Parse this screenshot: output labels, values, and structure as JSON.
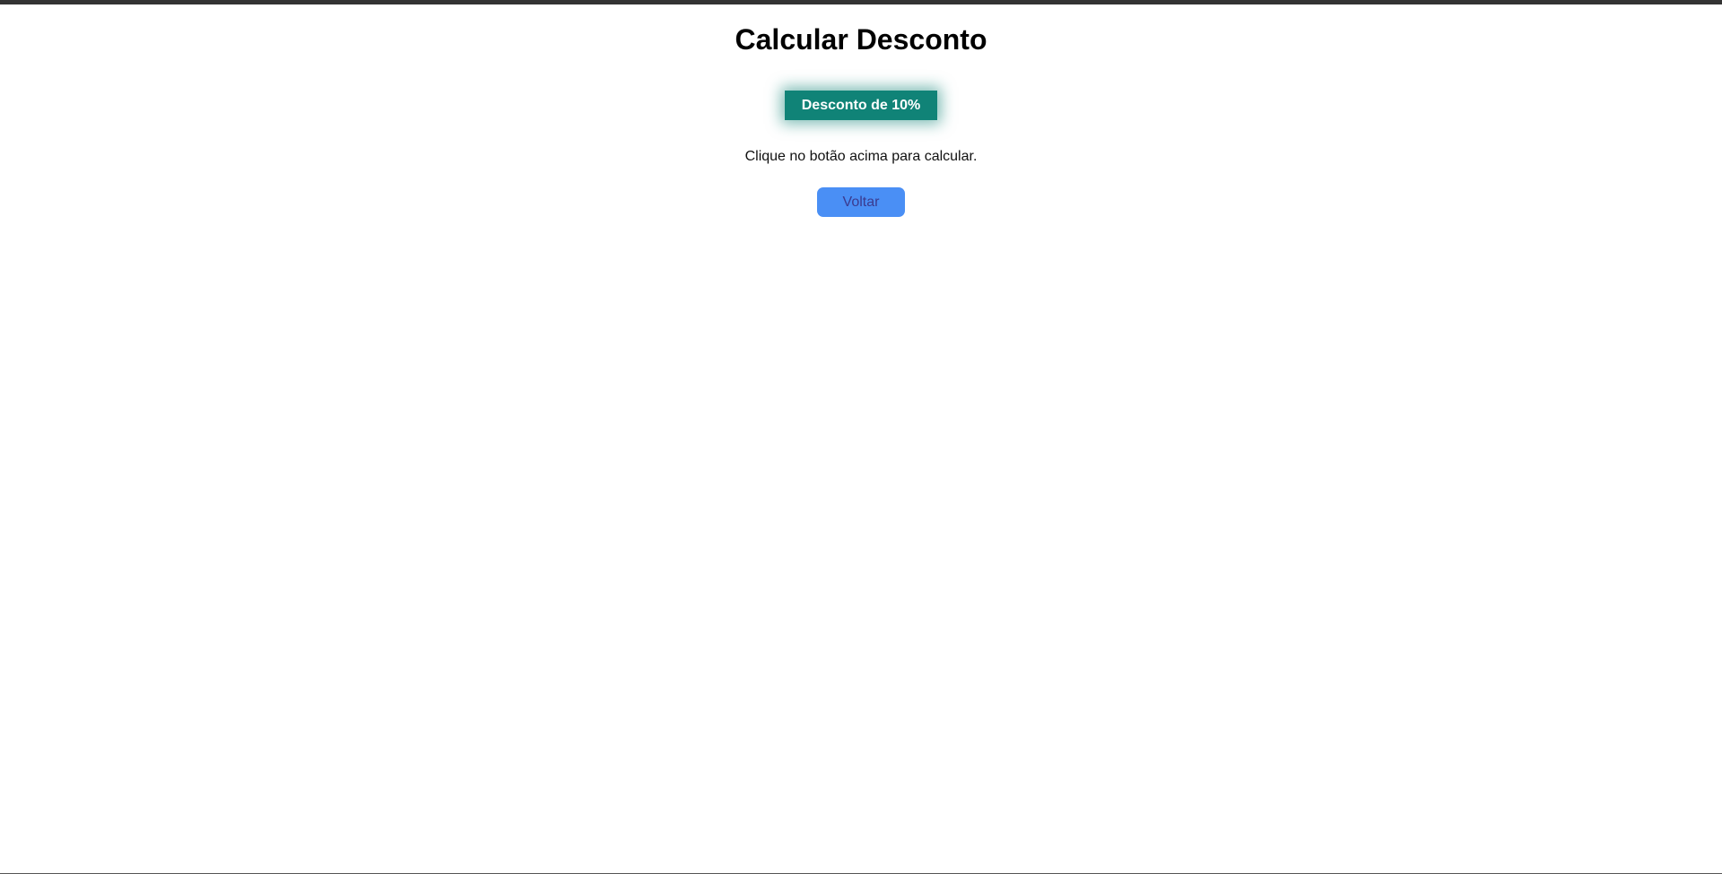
{
  "page": {
    "title": "Calcular Desconto",
    "instruction": "Clique no botão acima para calcular."
  },
  "buttons": {
    "discount_label": "Desconto de 10%",
    "back_label": "Voltar"
  },
  "colors": {
    "discount_button_bg": "#108377",
    "back_button_bg": "#4a8ff5",
    "back_button_text": "#3b3b8f",
    "top_bar": "#333333"
  }
}
